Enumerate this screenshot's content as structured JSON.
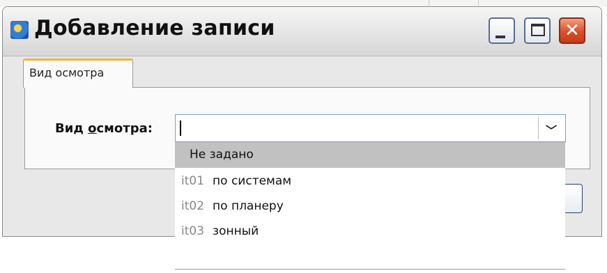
{
  "window": {
    "title": "Добавление записи",
    "buttons": {
      "minimize": "minimize",
      "maximize": "maximize",
      "close": "✕"
    }
  },
  "tabs": [
    {
      "label": "Вид осмотра",
      "active": true
    }
  ],
  "form": {
    "field_label_prefix": "Вид ",
    "field_label_mnemonic": "о",
    "field_label_suffix": "смотра:",
    "combo_value": ""
  },
  "dropdown": {
    "items": [
      {
        "code": "",
        "label": "Не задано",
        "selected": true
      },
      {
        "code": "it01",
        "label": "по системам",
        "selected": false
      },
      {
        "code": "it02",
        "label": "по планеру",
        "selected": false
      },
      {
        "code": "it03",
        "label": "зонный",
        "selected": false
      }
    ]
  },
  "ok_button": {
    "label": ""
  },
  "colors": {
    "selection": "#c1c1c1",
    "tab_accent": "#f0b33c",
    "close_button": "#d9502a"
  }
}
